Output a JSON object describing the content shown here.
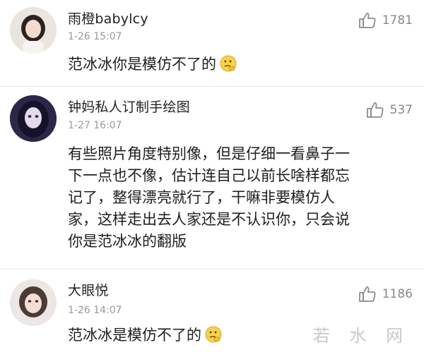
{
  "comments": [
    {
      "username": "雨橙babylcy",
      "timestamp": "1-26 15:07",
      "likes": "1781",
      "text": "范冰冰你是模仿不了的",
      "emoji": "thinking-face"
    },
    {
      "username": "钟妈私人订制手绘图",
      "timestamp": "1-27 16:07",
      "likes": "537",
      "lines": [
        "有些照片角度特别像，但是仔细一看鼻子一",
        "下一点也不像，估计连自己以前长啥样都忘",
        "记了，整得漂亮就行了，干嘛非要模仿人",
        "家，这样走出去人家还是不认识你，只会说",
        "你是范冰冰的翻版"
      ]
    },
    {
      "username": "大眼悦",
      "timestamp": "1-26 14:07",
      "likes": "1186",
      "text": "范冰冰是模仿不了的",
      "emoji": "thinking-face"
    }
  ],
  "watermark": "若 水 网",
  "icons": {
    "like": "thumbs-up-icon",
    "emoji": "thinking-face-emoji"
  }
}
